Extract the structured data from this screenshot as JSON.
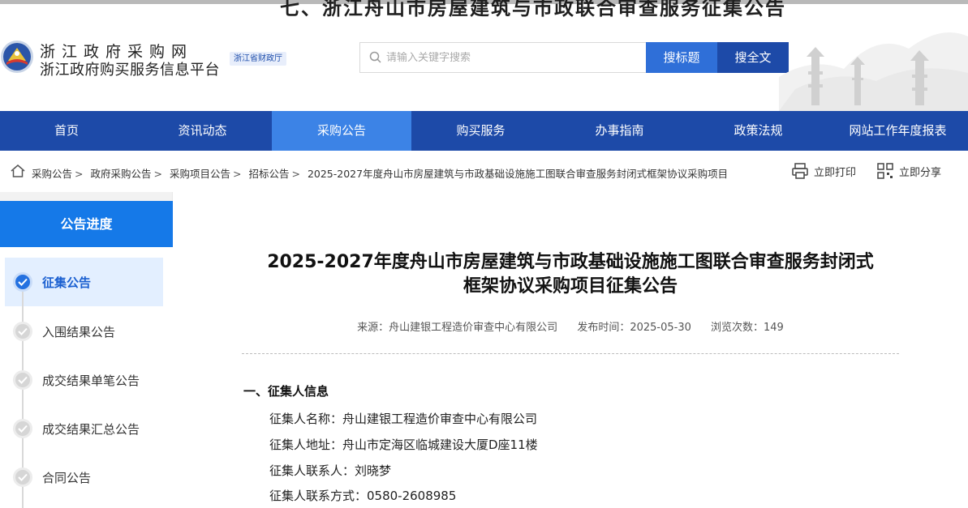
{
  "header": {
    "ghost_title": "七、浙江舟山市房屋建筑与市政联合审查服务征集公告",
    "site_name": "浙江政府采购网",
    "site_subtitle": "浙江政府购买服务信息平台",
    "dept_badge": "浙江省财政厅",
    "search": {
      "placeholder": "请输入关键字搜索",
      "value": "",
      "title_button": "搜标题",
      "fulltext_button": "搜全文"
    }
  },
  "nav": {
    "items": [
      {
        "label": "首页"
      },
      {
        "label": "资讯动态"
      },
      {
        "label": "采购公告"
      },
      {
        "label": "购买服务"
      },
      {
        "label": "办事指南"
      },
      {
        "label": "政策法规"
      },
      {
        "label": "网站工作年度报表"
      }
    ],
    "active_index": 2,
    "colors": {
      "bar": "#1d4aa8",
      "active": "#3c83e6"
    }
  },
  "breadcrumb": {
    "items": [
      "采购公告",
      "政府采购公告",
      "采购项目公告",
      "招标公告",
      "2025-2027年度舟山市房屋建筑与市政基础设施施工图联合审查服务封闭式框架协议采购项目"
    ],
    "separator": ">",
    "print_label": "立即打印",
    "share_label": "立即分享"
  },
  "sidebar": {
    "title": "公告进度",
    "steps": [
      {
        "label": "征集公告",
        "state": "active"
      },
      {
        "label": "入围结果公告",
        "state": "pending"
      },
      {
        "label": "成交结果单笔公告",
        "state": "pending"
      },
      {
        "label": "成交结果汇总公告",
        "state": "pending"
      },
      {
        "label": "合同公告",
        "state": "pending"
      }
    ]
  },
  "article": {
    "title_line1": "2025-2027年度舟山市房屋建筑与市政基础设施施工图联合审查服务封闭式",
    "title_line2": "框架协议采购项目征集公告",
    "source": "来源：舟山建银工程造价审查中心有限公司",
    "publish_time": "发布时间：2025-05-30",
    "views": "浏览次数：149",
    "section1_heading": "一、征集人信息",
    "fields": [
      "征集人名称：舟山建银工程造价审查中心有限公司",
      "征集人地址：舟山市定海区临城建设大厦D座11楼",
      "征集人联系人：刘晓梦",
      "征集人联系方式：0580-2608985"
    ]
  }
}
